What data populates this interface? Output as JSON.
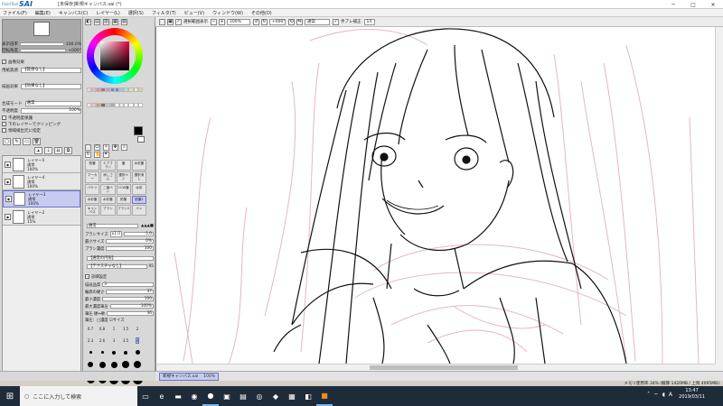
{
  "title_bar": {
    "brand_small": "PaintTool",
    "brand_big": "SAI",
    "title": "[未保存]新規キャンバス.sai (*)",
    "min_glyph": "─",
    "max_glyph": "□",
    "close_glyph": "✕"
  },
  "menu": [
    "ファイル(F)",
    "編集(E)",
    "キャンバス(C)",
    "レイヤー(L)",
    "選択(S)",
    "フィルタ(T)",
    "ビュー(V)",
    "ウィンドウ(W)",
    "その他(O)"
  ],
  "canvas_toolbar": {
    "selection_label": "選択範囲表示",
    "zoom": "100%",
    "angle": "+000°",
    "mode": "通常",
    "stabilizer_label": "手ブレ補正",
    "stabilizer_value": "14"
  },
  "navigator": {
    "zoom_label": "表示倍率",
    "zoom_value": "100.0%",
    "angle_label": "回転角度",
    "angle_value": "+000°"
  },
  "layer_props": {
    "section_label": "画像効果",
    "texture_label": "用紙質感",
    "texture_value": "【質感なし】",
    "effect_label": "描画効果",
    "effect_value": "【効果なし】",
    "blend_label": "合成モード",
    "blend_value": "通常",
    "opacity_label": "不透明度",
    "opacity_value": "100%",
    "options": [
      "不透明度保護",
      "下のレイヤーでクリッピング",
      "領域検出元に指定"
    ]
  },
  "layers": [
    {
      "name": "レイヤー5",
      "mode": "通常",
      "opacity": "100%"
    },
    {
      "name": "レイヤー4",
      "mode": "通常",
      "opacity": "100%"
    },
    {
      "name": "レイヤー3",
      "mode": "通常",
      "opacity": "100%"
    },
    {
      "name": "レイヤー2",
      "mode": "通常",
      "opacity": "15%"
    }
  ],
  "tools": [
    "鉛筆",
    "エアブラシ",
    "筆",
    "水彩筆",
    "マーカー",
    "消しゴム",
    "選択ペン",
    "選択消し",
    "バケツ",
    "二値ペン",
    "CCW筆",
    "水彩",
    "水彩筆",
    "水彩筆",
    "鉛筆",
    "鉛筆2",
    "キャンバス",
    "ブラシ",
    "ブラシ2",
    "ペン"
  ],
  "tool_options": {
    "mode": "通常",
    "brush_size_label": "ブラシサイズ",
    "brush_size_mult": "x1.0",
    "brush_size_value": "5.0",
    "min_size_label": "最小サイズ",
    "min_size_value": "0%",
    "density_label": "ブラシ濃度",
    "density_value": "100",
    "shape_label": "【通常の円形】",
    "texture_label": "【テクスチャなし】",
    "texture_strength": "95",
    "detail_label": "詳細設定",
    "quality_label": "描画品質",
    "quality_value": "3",
    "edge_label": "輪郭の硬さ",
    "edge_value": "37",
    "min_density_label": "最小濃度",
    "min_density_value": "100",
    "max_pressure_label": "最大濃度筆圧",
    "max_pressure_value": "100%",
    "pressure_label": "筆圧 硬⇔軟",
    "pressure_value": "36",
    "pressure_opts": "筆圧：□濃度 ☑サイズ"
  },
  "brush_sizes": [
    "0.7",
    "0.8",
    "1",
    "1.5",
    "2",
    "2.3",
    "2.6",
    "3",
    "3.5",
    "4"
  ],
  "document_tab": {
    "name": "新規キャンバス.sai",
    "zoom": "100%"
  },
  "memory_status": "メモリ使用率 34% (概算 1420MB / 上限 4095MB)",
  "taskbar": {
    "search_placeholder": "ここに入力して検索",
    "time": "13:47",
    "date": "2019/03/11"
  },
  "colors": {
    "accent": "#6d74c9",
    "selected_layer": "#c6cbf0",
    "sketch_pink": "#e3b8c2"
  }
}
